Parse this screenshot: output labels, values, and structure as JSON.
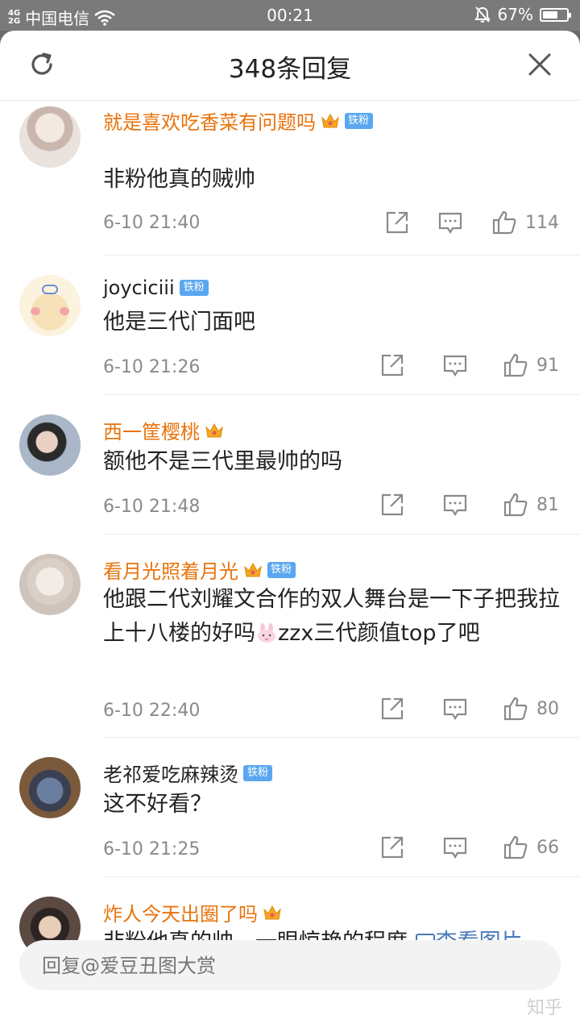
{
  "status_bar": {
    "network_top": "4G",
    "network_bottom": "2G",
    "carrier": "中国电信",
    "time": "00:21",
    "battery": "67%",
    "battery_level": 0.67
  },
  "header": {
    "title": "348条回复"
  },
  "comments": [
    {
      "username": "就是喜欢吃香菜有问题吗",
      "vip": true,
      "badge": "铁粉",
      "badge_combo": true,
      "text": "非粉他真的贼帅",
      "date": "6-10 21:40",
      "likes": "114"
    },
    {
      "username": "joyciciii",
      "vip": false,
      "badge": "铁粉",
      "badge_combo": false,
      "text": "他是三代门面吧",
      "date": "6-10 21:26",
      "likes": "91"
    },
    {
      "username": "西一筐樱桃",
      "vip": true,
      "badge": "",
      "badge_combo": false,
      "text": "额他不是三代里最帅的吗",
      "date": "6-10 21:48",
      "likes": "81"
    },
    {
      "username": "看月光照着月光",
      "vip": true,
      "badge": "铁粉",
      "badge_combo": true,
      "text_before_emoji": "他跟二代刘耀文合作的双人舞台是一下子把我拉上十八楼的好吗",
      "text_after_emoji": "zzx三代颜值top了吧",
      "emoji": "rabbit-emoji",
      "date": "6-10 22:40",
      "likes": "80"
    },
    {
      "username": "老祁爱吃麻辣烫",
      "vip": false,
      "badge": "铁粉",
      "badge_combo": false,
      "text": "这不好看？",
      "date": "6-10 21:25",
      "likes": "66"
    },
    {
      "username": "炸人今天出圈了吗",
      "vip": true,
      "badge": "",
      "badge_combo": false,
      "text": "非粉他真的帅，一眼惊艳的程度 ",
      "link": "查看图片"
    }
  ],
  "reply_bar": {
    "placeholder": "回复@爱豆丑图大赏"
  },
  "watermark": "知乎",
  "colors": {
    "vip_name": "#e8730c",
    "badge": "#5aa7f0",
    "link": "#4a7ab8",
    "meta": "#8a8a8a"
  }
}
